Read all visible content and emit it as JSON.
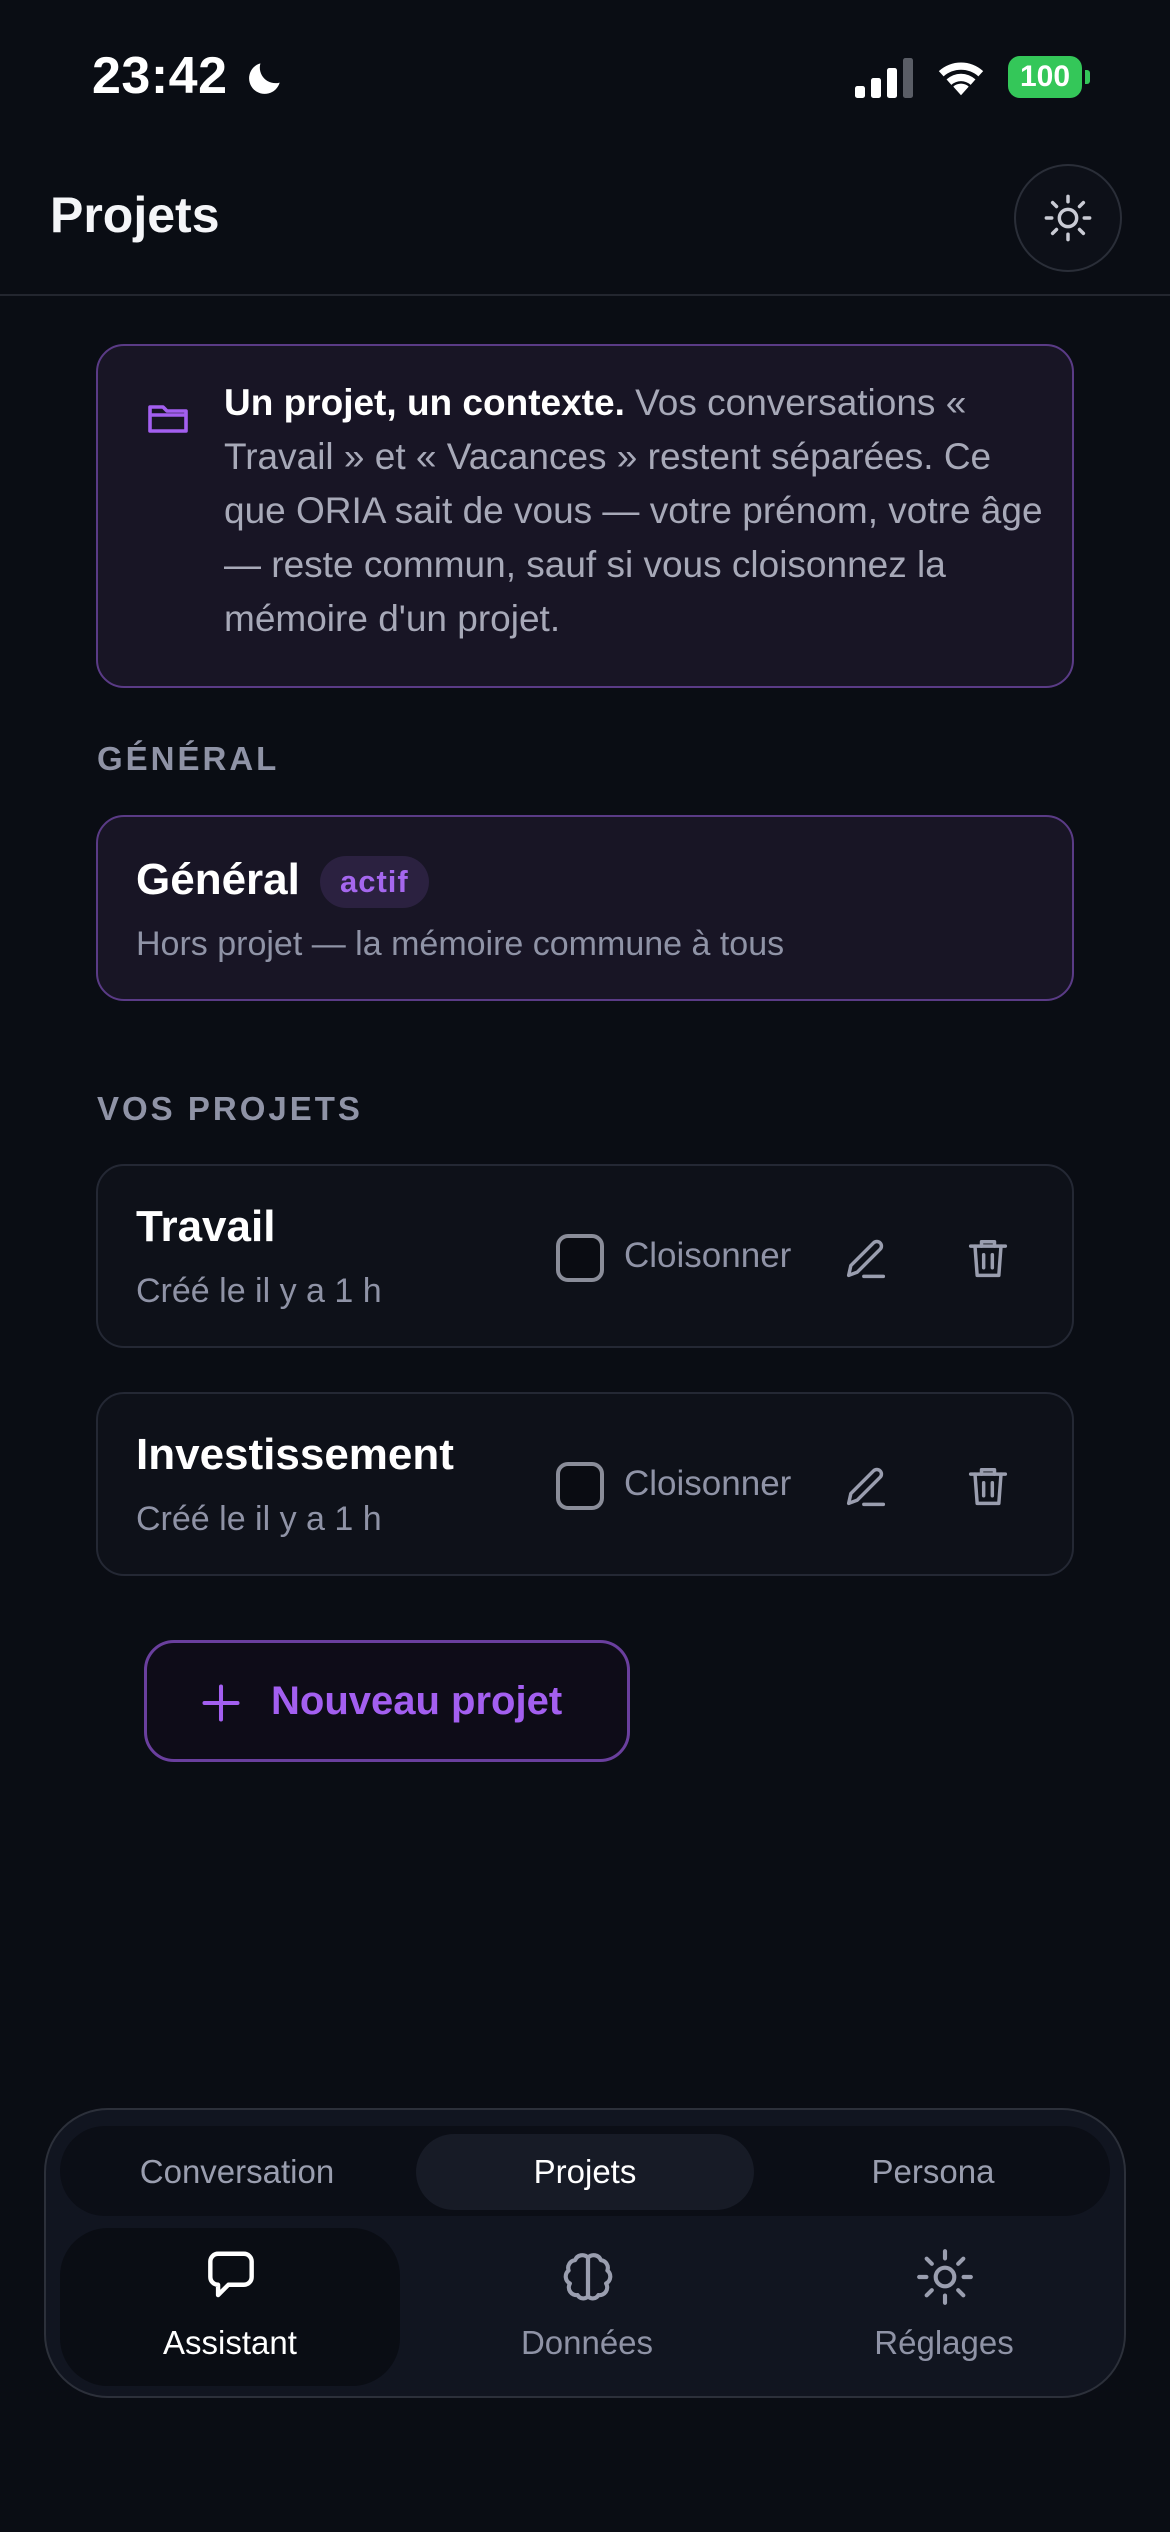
{
  "status_bar": {
    "time": "23:42",
    "battery": "100",
    "icons": [
      "moon-icon",
      "signal-icon",
      "wifi-icon",
      "battery-icon"
    ]
  },
  "header": {
    "title": "Projets",
    "theme_icon": "sun-icon"
  },
  "info": {
    "bold": "Un projet, un contexte.",
    "text": " Vos conversations « Travail » et « Vacances » restent séparées. Ce que ORIA sait de vous — votre prénom, votre âge — reste commun, sauf si vous cloisonnez la mémoire d'un projet.",
    "icon": "folder-icon"
  },
  "general_section": {
    "label": "GÉNÉRAL",
    "card": {
      "title": "Général",
      "badge": "actif",
      "subtitle": "Hors projet — la mémoire commune à tous"
    }
  },
  "projects_section": {
    "label": "VOS PROJETS",
    "projects": [
      {
        "name": "Travail",
        "date": "Créé le il y a 1 h",
        "isolate_label": "Cloisonner",
        "isolated": false
      },
      {
        "name": "Investissement",
        "date": "Créé le il y a 1 h",
        "isolate_label": "Cloisonner",
        "isolated": false
      }
    ]
  },
  "new_project": {
    "label": "Nouveau projet"
  },
  "bottom_nav": {
    "segments": [
      {
        "label": "Conversation",
        "active": false
      },
      {
        "label": "Projets",
        "active": true
      },
      {
        "label": "Persona",
        "active": false
      }
    ],
    "items": [
      {
        "label": "Assistant",
        "icon": "chat-bubble-icon",
        "active": true
      },
      {
        "label": "Données",
        "icon": "brain-icon",
        "active": false
      },
      {
        "label": "Réglages",
        "icon": "sun-icon",
        "active": false
      }
    ]
  },
  "colors": {
    "background": "#0a0d14",
    "accent": "#a35ff0",
    "accent_border": "#5a3b86",
    "battery": "#34c759"
  }
}
